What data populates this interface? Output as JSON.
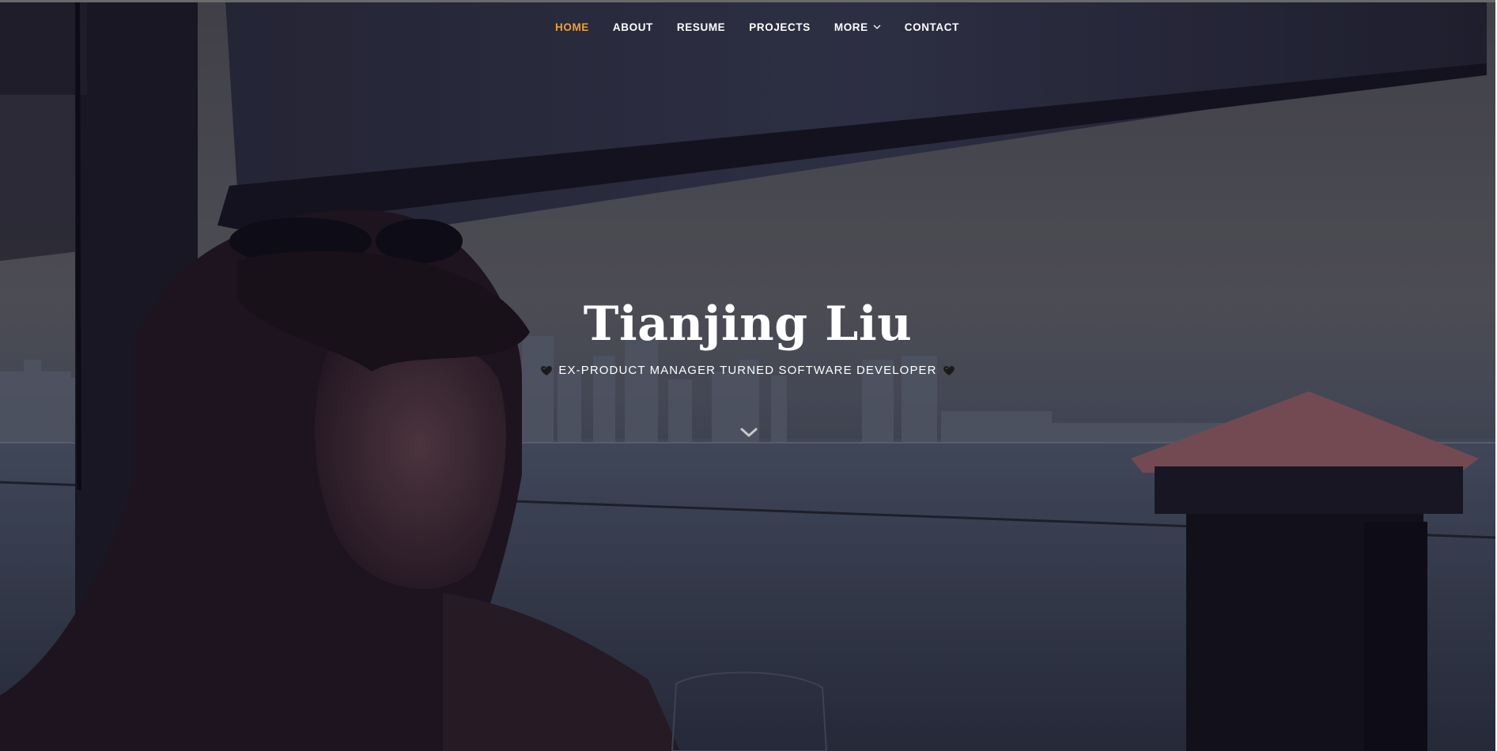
{
  "nav": {
    "items": [
      {
        "label": "HOME",
        "active": true
      },
      {
        "label": "ABOUT",
        "active": false
      },
      {
        "label": "RESUME",
        "active": false
      },
      {
        "label": "PROJECTS",
        "active": false
      },
      {
        "label": "MORE",
        "active": false,
        "has_dropdown": true
      },
      {
        "label": "CONTACT",
        "active": false
      }
    ],
    "active_color": "#f0a030",
    "text_color": "#ffffff"
  },
  "hero": {
    "title": "Tianjing Liu",
    "subtitle": "EX-PRODUCT MANAGER TURNED SOFTWARE DEVELOPER",
    "subtitle_icon": "black-heart-icon",
    "scroll_icon": "chevron-down-icon",
    "background": "photo-woman-by-waterfront-city-skyline"
  }
}
